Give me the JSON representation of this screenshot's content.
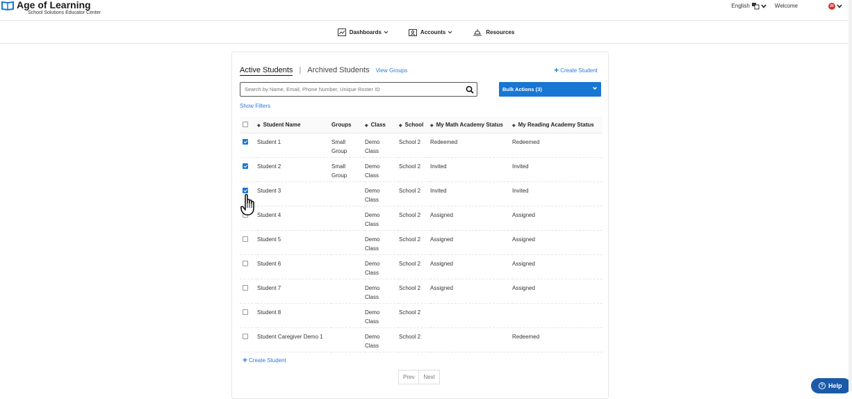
{
  "header": {
    "brand": "Age of Learning",
    "brand_sub": "School Solutions Educator Center",
    "language": "English",
    "welcome": "Welcome",
    "badge": "20"
  },
  "nav": {
    "dashboards": "Dashboards",
    "accounts": "Accounts",
    "resources": "Resources"
  },
  "tabs": {
    "active": "Active Students",
    "separator": "|",
    "archived": "Archived Students",
    "view_groups": "View Groups"
  },
  "create_student": "Create Student",
  "search": {
    "placeholder": "Search by Name, Email, Phone Number, Unique Roster ID"
  },
  "bulk_actions": "Bulk Actions (3)",
  "show_filters": "Show Filters",
  "table": {
    "headers": {
      "name": "Student Name",
      "groups": "Groups",
      "class": "Class",
      "school": "School",
      "math": "My Math Academy Status",
      "reading": "My Reading Academy Status"
    },
    "rows": [
      {
        "checked": true,
        "name": "Student 1",
        "groups1": "Small",
        "groups2": "Group",
        "class1": "Demo",
        "class2": "Class",
        "school": "School 2",
        "math": "Redeemed",
        "reading": "Redeemed"
      },
      {
        "checked": true,
        "name": "Student 2",
        "groups1": "Small",
        "groups2": "Group",
        "class1": "Demo",
        "class2": "Class",
        "school": "School 2",
        "math": "Invited",
        "reading": "Invited"
      },
      {
        "checked": true,
        "name": "Student 3",
        "groups1": "",
        "groups2": "",
        "class1": "Demo",
        "class2": "Class",
        "school": "School 2",
        "math": "Invited",
        "reading": "Invited"
      },
      {
        "checked": false,
        "name": "Student 4",
        "groups1": "",
        "groups2": "",
        "class1": "Demo",
        "class2": "Class",
        "school": "School 2",
        "math": "Assigned",
        "reading": "Assigned"
      },
      {
        "checked": false,
        "name": "Student 5",
        "groups1": "",
        "groups2": "",
        "class1": "Demo",
        "class2": "Class",
        "school": "School 2",
        "math": "Assigned",
        "reading": "Assigned"
      },
      {
        "checked": false,
        "name": "Student 6",
        "groups1": "",
        "groups2": "",
        "class1": "Demo",
        "class2": "Class",
        "school": "School 2",
        "math": "Assigned",
        "reading": "Assigned"
      },
      {
        "checked": false,
        "name": "Student 7",
        "groups1": "",
        "groups2": "",
        "class1": "Demo",
        "class2": "Class",
        "school": "School 2",
        "math": "Assigned",
        "reading": "Assigned"
      },
      {
        "checked": false,
        "name": "Student 8",
        "groups1": "",
        "groups2": "",
        "class1": "Demo",
        "class2": "Class",
        "school": "School 2",
        "math": "",
        "reading": ""
      },
      {
        "checked": false,
        "name": "Student Caregiver Demo 1",
        "groups1": "",
        "groups2": "",
        "class1": "Demo",
        "class2": "Class",
        "school": "School 2",
        "math": "",
        "reading": "Redeemed"
      }
    ]
  },
  "pager": {
    "prev": "Prev",
    "next": "Next"
  },
  "help": "Help",
  "colors": {
    "accent": "#1976d2",
    "link": "#2a7bd8",
    "help": "#1a5aa8"
  }
}
